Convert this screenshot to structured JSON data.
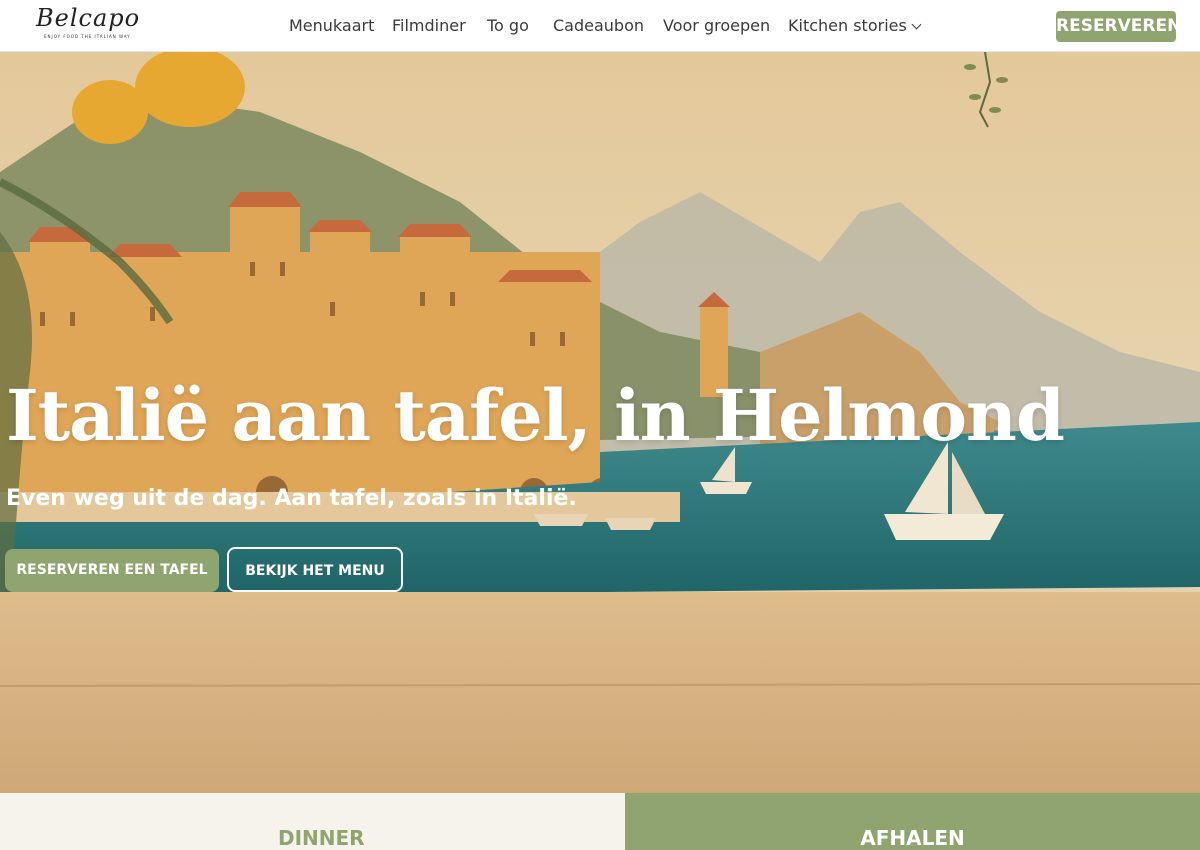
{
  "header": {
    "logo_text": "Belcapo",
    "logo_tagline": "ENJOY FOOD THE ITALIAN WAY",
    "nav": [
      "Menukaart",
      "Filmdiner",
      "To go",
      "Cadeaubon",
      "Voor groepen",
      "Kitchen stories"
    ],
    "reserve_label": "RESERVEREN"
  },
  "hero": {
    "title": "Italië aan tafel, in Helmond",
    "subtitle": "Even weg uit de dag. Aan tafel, zoals in Italië.",
    "primary_button": "RESERVEREN EEN TAFEL",
    "secondary_button": "BEKIJK HET MENU"
  },
  "tabs": {
    "dinner": "DINNER",
    "afhalen": "AFHALEN"
  },
  "colors": {
    "accent": "#8fa46e",
    "cream": "#f6f3ec",
    "nav_text": "#3b3b3b"
  },
  "icons": {
    "dropdown": "chevron-down-icon"
  }
}
